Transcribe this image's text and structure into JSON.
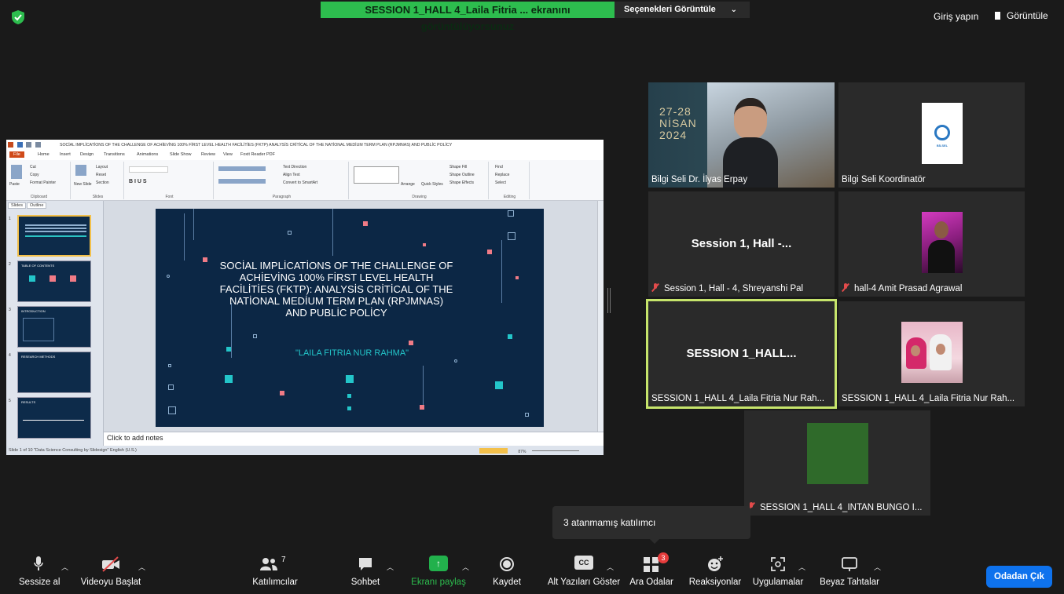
{
  "top_bar": {
    "share_banner": "SESSION 1_HALL 4_Laila Fitria ... ekranını görüntülüyorsunuz",
    "options_label": "Seçenekleri Görüntüle",
    "login_label": "Giriş yapın",
    "view_label": "Görüntüle"
  },
  "ppt": {
    "window_title": "SOCİAL IMPLİCATİONS OF THE CHALLENGE OF ACHİEVİNG 100% FİRST LEVEL HEALTH FACİLİTİES (FKTP) ANALYSİS CRİTİCAL OF THE NATİONAL MEDİUM TERM PLAN (RPJMNAS) AND PUBLİC POLİCY",
    "tabs": [
      "File",
      "Home",
      "Insert",
      "Design",
      "Transitions",
      "Animations",
      "Slide Show",
      "Review",
      "View",
      "Foxit Reader PDF"
    ],
    "ribbon_groups": [
      "Clipboard",
      "Slides",
      "Font",
      "Paragraph",
      "Drawing",
      "Editing"
    ],
    "clipboard_items": [
      "Cut",
      "Copy",
      "Format Painter",
      "Paste"
    ],
    "slides_items": [
      "Layout",
      "Reset",
      "Section",
      "New Slide"
    ],
    "paragraph_items": [
      "Text Direction",
      "Align Text",
      "Convert to SmartArt"
    ],
    "drawing_items": [
      "Shape Fill",
      "Shape Outline",
      "Shape Effects",
      "Arrange",
      "Quick Styles"
    ],
    "editing_items": [
      "Find",
      "Replace",
      "Select"
    ],
    "left_tabs": [
      "Slides",
      "Outline"
    ],
    "thumbnail_numbers": [
      "1",
      "2",
      "3",
      "4",
      "5"
    ],
    "thumbnail_titles": [
      "",
      "TABLE OF CONTENTS",
      "INTRODUCTION",
      "RESEARCH METHODS",
      "RESULTS"
    ],
    "slide_title": "SOCİAL IMPLİCATİONS OF THE CHALLENGE OF ACHİEVİNG 100% FİRST LEVEL HEALTH FACİLİTİES (FKTP): ANALYSİS CRİTİCAL OF THE NATİONAL MEDİUM TERM PLAN (RPJMNAS) AND PUBLİC POLİCY",
    "slide_author": "\"LAILA FITRIA NUR RAHMA\"",
    "notes_placeholder": "Click to add notes",
    "status_text": "Slide 1 of 10   \"Data Science Consulting by Slidesign\"   English (U.S.)",
    "zoom_text": "87%"
  },
  "participants": [
    {
      "name": "Bilgi Seli Dr. İlyas Erpay",
      "date_lines": [
        "27-28",
        "NİSAN",
        "2024"
      ],
      "muted": false
    },
    {
      "name": "Bilgi Seli Koordinatör",
      "logo_text": "BİLSEL",
      "muted": false
    },
    {
      "name": "Session 1, Hall - 4, Shreyanshi Pal",
      "big_label": "Session 1, Hall -...",
      "muted": true
    },
    {
      "name": "hall-4 Amit Prasad Agrawal",
      "muted": true
    },
    {
      "name": "SESSION 1_HALL 4_Laila Fitria Nur Rah...",
      "big_label": "SESSION  1_HALL...",
      "muted": false,
      "active": true
    },
    {
      "name": "SESSION 1_HALL 4_Laila Fitria Nur Rah...",
      "muted": false
    },
    {
      "name": "SESSION 1_HALL 4_INTAN BUNGO I...",
      "muted": true
    }
  ],
  "tooltip": "3 atanmamış katılımcı",
  "toolbar": {
    "mute": "Sessize al",
    "video": "Videoyu Başlat",
    "participants": "Katılımcılar",
    "participants_count": "7",
    "chat": "Sohbet",
    "share": "Ekranı paylaş",
    "record": "Kaydet",
    "captions": "Alt Yazıları Göster",
    "captions_icon_text": "CC",
    "breakout": "Ara Odalar",
    "breakout_badge": "3",
    "reactions": "Reaksiyonlar",
    "apps": "Uygulamalar",
    "whiteboard": "Beyaz Tahtalar",
    "leave": "Odadan Çık"
  },
  "colors": {
    "share_banner": "#2dbd4e",
    "active_border": "#c6e46b",
    "leave_button": "#0e72ed",
    "muted_icon": "#e24b4b",
    "slide_bg": "#0c2745",
    "slide_accent": "#23c5c9"
  }
}
